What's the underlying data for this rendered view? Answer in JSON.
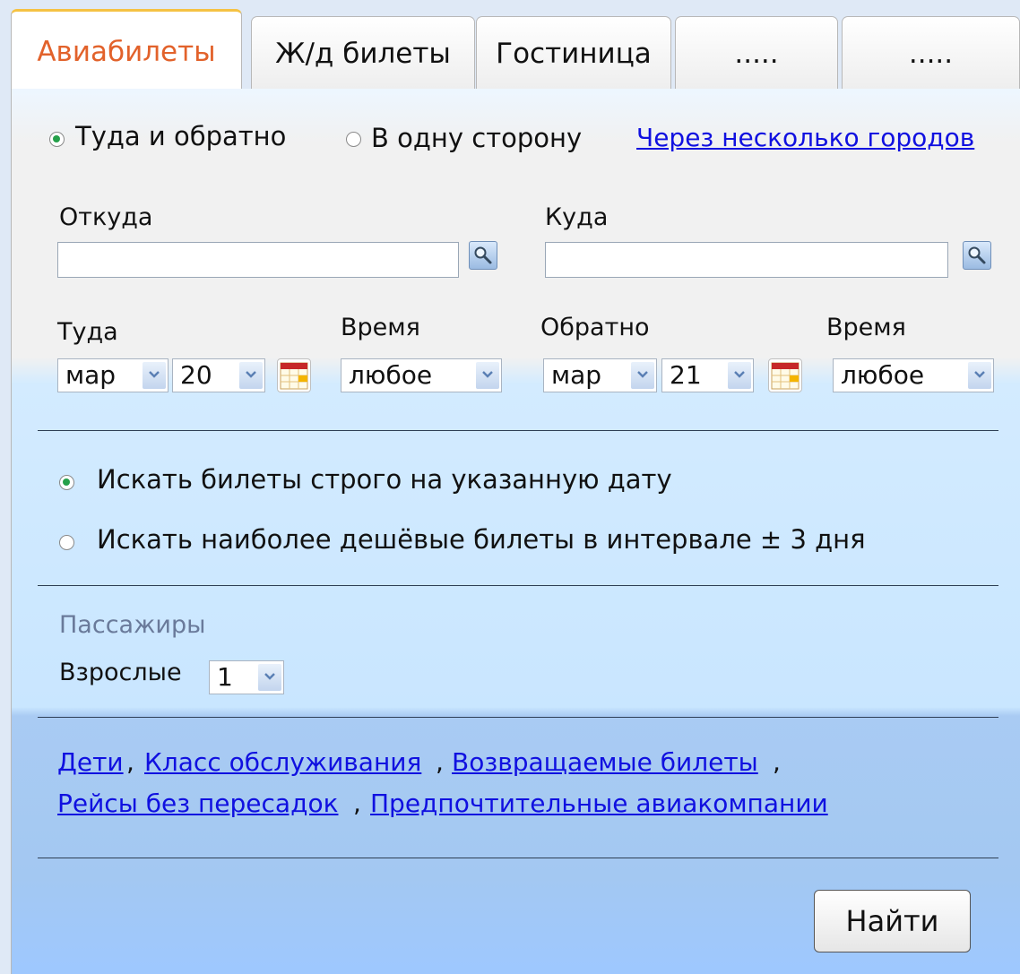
{
  "tabs": [
    {
      "label": "Авиабилеты",
      "active": true
    },
    {
      "label": "Ж/д билеты"
    },
    {
      "label": "Гостиница"
    },
    {
      "label": "....."
    },
    {
      "label": "....."
    }
  ],
  "trip_type": {
    "round_trip": "Туда и обратно",
    "one_way": "В одну сторону",
    "multi_city_link": "Через несколько городов",
    "selected": "round_trip"
  },
  "route": {
    "from_label": "Откуда",
    "from_value": "",
    "to_label": "Куда",
    "to_value": ""
  },
  "dates": {
    "depart_label": "Туда",
    "depart_month": "мар",
    "depart_day": "20",
    "depart_time_label": "Время",
    "depart_time": "любое",
    "return_label": "Обратно",
    "return_month": "мар",
    "return_day": "21",
    "return_time_label": "Время",
    "return_time": "любое"
  },
  "search_mode": {
    "exact_date": "Искать билеты строго на указанную дату",
    "flexible": "Искать наиболее дешёвые билеты в интервале ± 3 дня",
    "selected": "exact_date"
  },
  "passengers": {
    "title": "Пассажиры",
    "adults_label": "Взрослые",
    "adults_value": "1"
  },
  "options_links": {
    "children": "Дети",
    "service_class": "Класс обслуживания",
    "refundable": "Возвращаемые билеты",
    "nonstop": "Рейсы без пересадок",
    "airlines": "Предпочтительные авиакомпании"
  },
  "actions": {
    "search_button": "Найти"
  },
  "colors": {
    "active_tab_text": "#e2622b",
    "link": "#1010e0",
    "radio_selected": "#25a04a"
  }
}
